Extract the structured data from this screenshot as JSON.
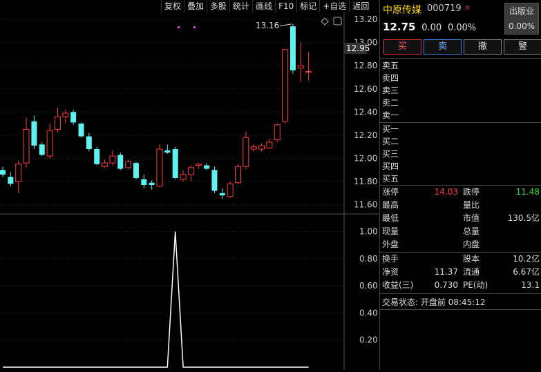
{
  "toolbar": {
    "buttons": [
      "复权",
      "叠加",
      "多股",
      "统计",
      "画线",
      "F10",
      "标记",
      "+自选",
      "返回"
    ]
  },
  "chart": {
    "price_axis": [
      "13.20",
      "13.00",
      "12.80",
      "12.60",
      "12.40",
      "12.20",
      "12.00",
      "11.80",
      "11.60"
    ],
    "current_price_tag": "12.95",
    "high_annotation": "13.16",
    "indicator_axis": [
      "1.00",
      "0.80",
      "0.60",
      "0.40",
      "0.20"
    ]
  },
  "chart_data": [
    {
      "type": "candlestick",
      "title": "",
      "ylim": [
        11.52,
        13.26
      ],
      "y_ticks": [
        13.2,
        13.0,
        12.8,
        12.6,
        12.4,
        12.2,
        12.0,
        11.8,
        11.6
      ],
      "up_color": "#ff3c3c",
      "down_color": "#5ff0f0",
      "candles": [
        {
          "o": 11.9,
          "h": 11.93,
          "l": 11.84,
          "c": 11.86
        },
        {
          "o": 11.84,
          "h": 11.88,
          "l": 11.76,
          "c": 11.78
        },
        {
          "o": 11.8,
          "h": 11.98,
          "l": 11.7,
          "c": 11.95
        },
        {
          "o": 11.96,
          "h": 12.35,
          "l": 11.92,
          "c": 12.25
        },
        {
          "o": 12.32,
          "h": 12.37,
          "l": 12.08,
          "c": 12.11
        },
        {
          "o": 12.12,
          "h": 12.14,
          "l": 12.02,
          "c": 12.03
        },
        {
          "o": 12.02,
          "h": 12.3,
          "l": 12.0,
          "c": 12.24
        },
        {
          "o": 12.25,
          "h": 12.44,
          "l": 12.22,
          "c": 12.36
        },
        {
          "o": 12.36,
          "h": 12.42,
          "l": 12.3,
          "c": 12.39
        },
        {
          "o": 12.4,
          "h": 12.42,
          "l": 12.29,
          "c": 12.31
        },
        {
          "o": 12.3,
          "h": 12.31,
          "l": 12.18,
          "c": 12.19
        },
        {
          "o": 12.19,
          "h": 12.22,
          "l": 12.06,
          "c": 12.08
        },
        {
          "o": 12.08,
          "h": 12.1,
          "l": 11.94,
          "c": 11.95
        },
        {
          "o": 11.93,
          "h": 11.99,
          "l": 11.92,
          "c": 11.96
        },
        {
          "o": 11.96,
          "h": 12.07,
          "l": 11.94,
          "c": 12.02
        },
        {
          "o": 12.03,
          "h": 12.05,
          "l": 11.9,
          "c": 11.91
        },
        {
          "o": 11.92,
          "h": 11.99,
          "l": 11.91,
          "c": 11.97
        },
        {
          "o": 11.96,
          "h": 11.97,
          "l": 11.82,
          "c": 11.83
        },
        {
          "o": 11.82,
          "h": 11.86,
          "l": 11.74,
          "c": 11.77
        },
        {
          "o": 11.79,
          "h": 11.81,
          "l": 11.73,
          "c": 11.77
        },
        {
          "o": 11.76,
          "h": 12.12,
          "l": 11.75,
          "c": 12.08
        },
        {
          "o": 12.07,
          "h": 12.12,
          "l": 12.04,
          "c": 12.05
        },
        {
          "o": 12.08,
          "h": 12.1,
          "l": 11.82,
          "c": 11.83
        },
        {
          "o": 11.82,
          "h": 11.9,
          "l": 11.8,
          "c": 11.86
        },
        {
          "o": 11.86,
          "h": 11.94,
          "l": 11.8,
          "c": 11.92
        },
        {
          "o": 11.94,
          "h": 11.96,
          "l": 11.91,
          "c": 11.95
        },
        {
          "o": 11.94,
          "h": 11.96,
          "l": 11.9,
          "c": 11.91
        },
        {
          "o": 11.9,
          "h": 11.93,
          "l": 11.7,
          "c": 11.72
        },
        {
          "o": 11.7,
          "h": 11.74,
          "l": 11.65,
          "c": 11.68
        },
        {
          "o": 11.67,
          "h": 11.8,
          "l": 11.66,
          "c": 11.78
        },
        {
          "o": 11.79,
          "h": 11.95,
          "l": 11.78,
          "c": 11.93
        },
        {
          "o": 11.93,
          "h": 12.23,
          "l": 11.91,
          "c": 12.18
        },
        {
          "o": 12.08,
          "h": 12.12,
          "l": 12.06,
          "c": 12.1
        },
        {
          "o": 12.08,
          "h": 12.13,
          "l": 12.06,
          "c": 12.11
        },
        {
          "o": 12.09,
          "h": 12.17,
          "l": 12.08,
          "c": 12.14
        },
        {
          "o": 12.16,
          "h": 12.3,
          "l": 12.14,
          "c": 12.29
        },
        {
          "o": 12.32,
          "h": 12.94,
          "l": 12.3,
          "c": 12.94
        },
        {
          "o": 13.14,
          "h": 13.16,
          "l": 12.73,
          "c": 12.76
        },
        {
          "o": 12.78,
          "h": 13.0,
          "l": 12.66,
          "c": 12.8
        },
        {
          "o": 12.75,
          "h": 12.92,
          "l": 12.67,
          "c": 12.75
        }
      ]
    },
    {
      "type": "line",
      "title": "",
      "ylim": [
        0,
        1.12
      ],
      "y_ticks": [
        1.0,
        0.8,
        0.6,
        0.4,
        0.2
      ],
      "line_color": "#ffffff",
      "values": [
        0,
        0,
        0,
        0,
        0,
        0,
        0,
        0,
        0,
        0,
        0,
        0,
        0,
        0,
        0,
        0,
        0,
        0,
        0,
        0,
        0,
        0,
        1,
        0,
        0,
        0,
        0,
        0,
        0,
        0,
        0,
        0,
        0,
        0,
        0,
        0,
        0,
        0,
        0,
        0
      ]
    }
  ],
  "stock": {
    "name": "中原传媒",
    "code": "000719",
    "badge": "R",
    "sector_line1": "出版业",
    "sector_line2": "0.00%",
    "price": "12.75",
    "change": "0.00",
    "change_pct": "0.00%"
  },
  "trade_buttons": [
    "买",
    "卖",
    "撤",
    "警"
  ],
  "order_book": {
    "sell": [
      "卖五",
      "卖四",
      "卖三",
      "卖二",
      "卖一"
    ],
    "buy": [
      "买一",
      "买二",
      "买三",
      "买四",
      "买五"
    ]
  },
  "stats": [
    {
      "k1": "涨停",
      "v1": "14.03",
      "k2": "跌停",
      "v2": "11.48"
    },
    {
      "k1": "最高",
      "v1": "",
      "k2": "量比",
      "v2": ""
    },
    {
      "k1": "最低",
      "v1": "",
      "k2": "市值",
      "v2": "130.5亿"
    },
    {
      "k1": "现量",
      "v1": "",
      "k2": "总量",
      "v2": ""
    },
    {
      "k1": "外盘",
      "v1": "",
      "k2": "内盘",
      "v2": ""
    },
    {
      "k1": "换手",
      "v1": "",
      "k2": "股本",
      "v2": "10.2亿"
    },
    {
      "k1": "净资",
      "v1": "11.37",
      "k2": "流通",
      "v2": "6.67亿"
    },
    {
      "k1": "收益(三)",
      "v1": "0.730",
      "k2": "PE(动)",
      "v2": "13.1"
    }
  ],
  "trade_status": "交易状态: 开盘前 08:45:12",
  "colors": {
    "up": "#ff3c3c",
    "down": "#5ff0f0",
    "accent": "#ffd700"
  }
}
